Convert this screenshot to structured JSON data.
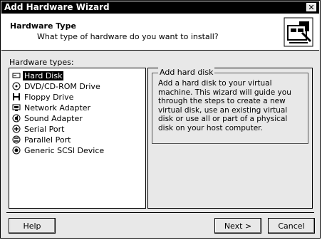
{
  "window": {
    "title": "Add Hardware Wizard"
  },
  "header": {
    "title": "Hardware Type",
    "subtitle": "What type of hardware do you want to install?"
  },
  "list": {
    "label": "Hardware types:",
    "selected_index": 0,
    "items": [
      {
        "label": "Hard Disk",
        "icon": "hard-disk-icon"
      },
      {
        "label": "DVD/CD-ROM Drive",
        "icon": "cd-rom-icon"
      },
      {
        "label": "Floppy Drive",
        "icon": "floppy-drive-icon"
      },
      {
        "label": "Network Adapter",
        "icon": "network-adapter-icon"
      },
      {
        "label": "Sound Adapter",
        "icon": "sound-adapter-icon"
      },
      {
        "label": "Serial Port",
        "icon": "serial-port-icon"
      },
      {
        "label": "Parallel Port",
        "icon": "parallel-port-icon"
      },
      {
        "label": "Generic SCSI Device",
        "icon": "scsi-device-icon"
      }
    ]
  },
  "description": {
    "title": "Add hard disk",
    "text": "Add a hard disk to your virtual machine. This wizard will guide you through the steps to create a new virtual disk, use an existing virtual disk or use all or part of a physical disk on your host computer."
  },
  "buttons": {
    "help": "Help",
    "next": "Next >",
    "cancel": "Cancel"
  }
}
